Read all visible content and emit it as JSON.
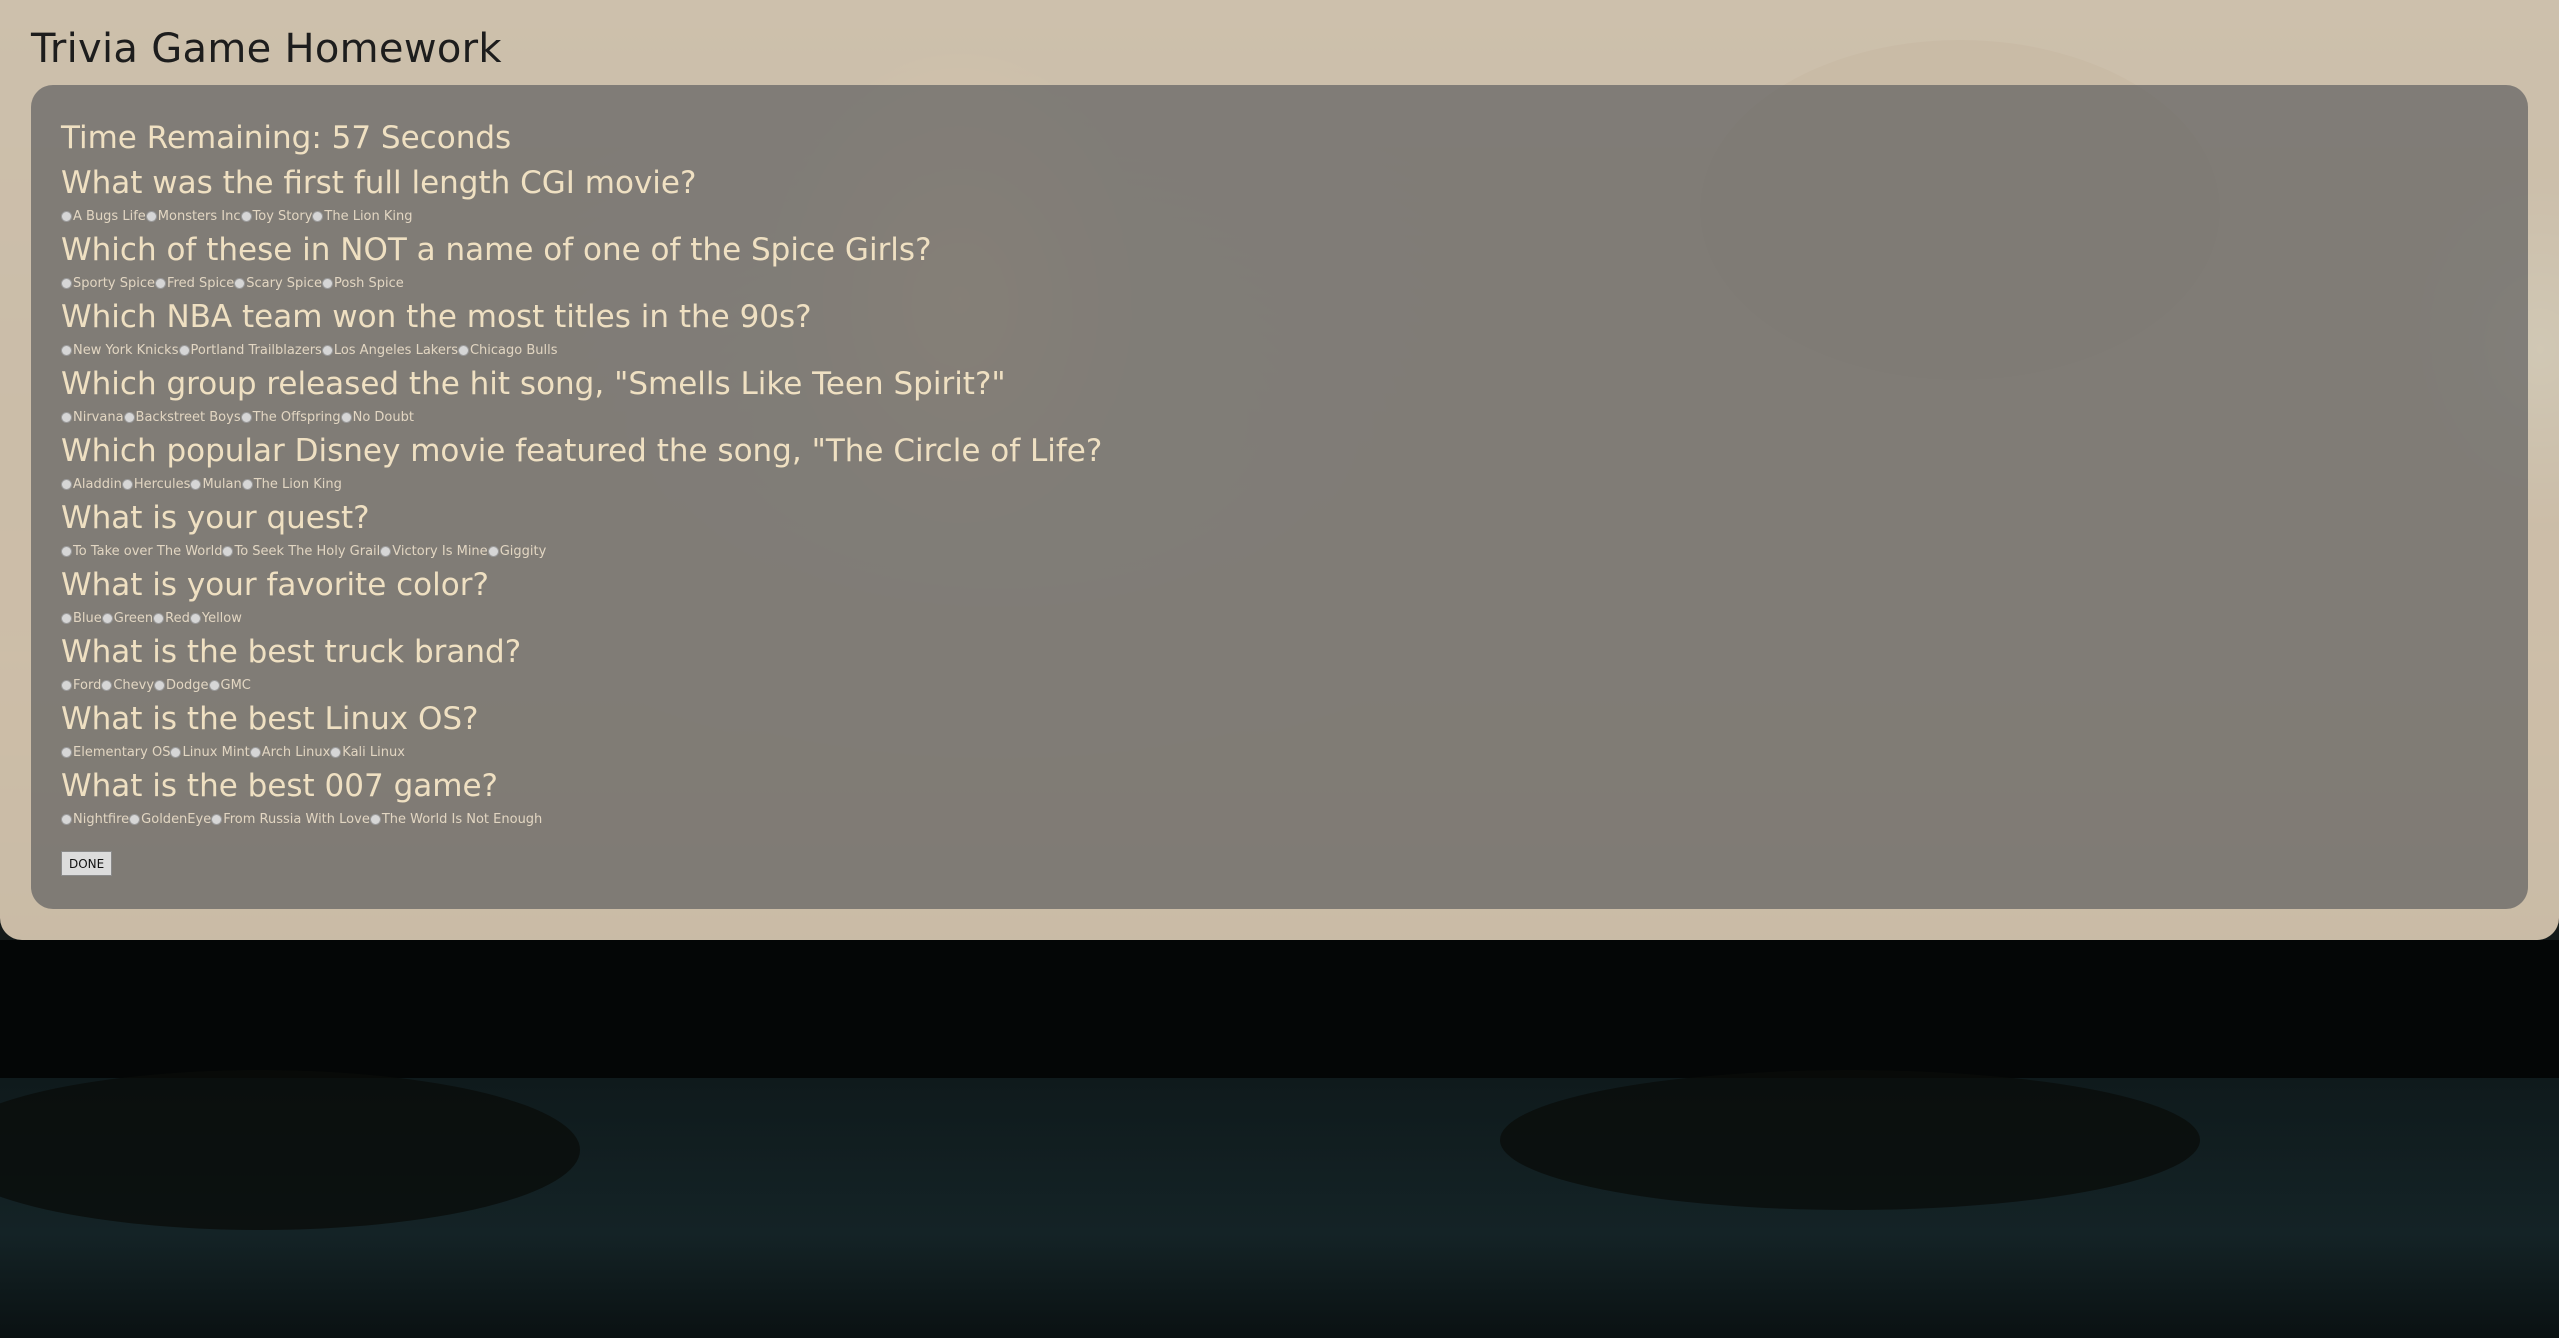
{
  "page_title": "Trivia Game Homework",
  "timer": "Time Remaining: 57 Seconds",
  "questions": [
    {
      "text": "What was the first full length CGI movie?",
      "options": [
        "A Bugs Life",
        "Monsters Inc",
        "Toy Story",
        "The Lion King"
      ]
    },
    {
      "text": "Which of these in NOT a name of one of the Spice Girls?",
      "options": [
        "Sporty Spice",
        "Fred Spice",
        "Scary Spice",
        "Posh Spice"
      ]
    },
    {
      "text": "Which NBA team won the most titles in the 90s?",
      "options": [
        "New York Knicks",
        "Portland Trailblazers",
        "Los Angeles Lakers",
        "Chicago Bulls"
      ]
    },
    {
      "text": "Which group released the hit song, \"Smells Like Teen Spirit?\"",
      "options": [
        "Nirvana",
        "Backstreet Boys",
        "The Offspring",
        "No Doubt"
      ]
    },
    {
      "text": "Which popular Disney movie featured the song, \"The Circle of Life?",
      "options": [
        "Aladdin",
        "Hercules",
        "Mulan",
        "The Lion King"
      ]
    },
    {
      "text": "What is your quest?",
      "options": [
        "To Take over The World",
        "To Seek The Holy Grail",
        "Victory Is Mine",
        "Giggity"
      ]
    },
    {
      "text": "What is your favorite color?",
      "options": [
        "Blue",
        "Green",
        "Red",
        "Yellow"
      ]
    },
    {
      "text": "What is the best truck brand?",
      "options": [
        "Ford",
        "Chevy",
        "Dodge",
        "GMC"
      ]
    },
    {
      "text": "What is the best Linux OS?",
      "options": [
        "Elementary OS",
        "Linux Mint",
        "Arch Linux",
        "Kali Linux"
      ]
    },
    {
      "text": "What is the best 007 game?",
      "options": [
        "Nightfire",
        "GoldenEye",
        "From Russia With Love",
        "The World Is Not Enough"
      ]
    }
  ],
  "done_label": "DONE"
}
